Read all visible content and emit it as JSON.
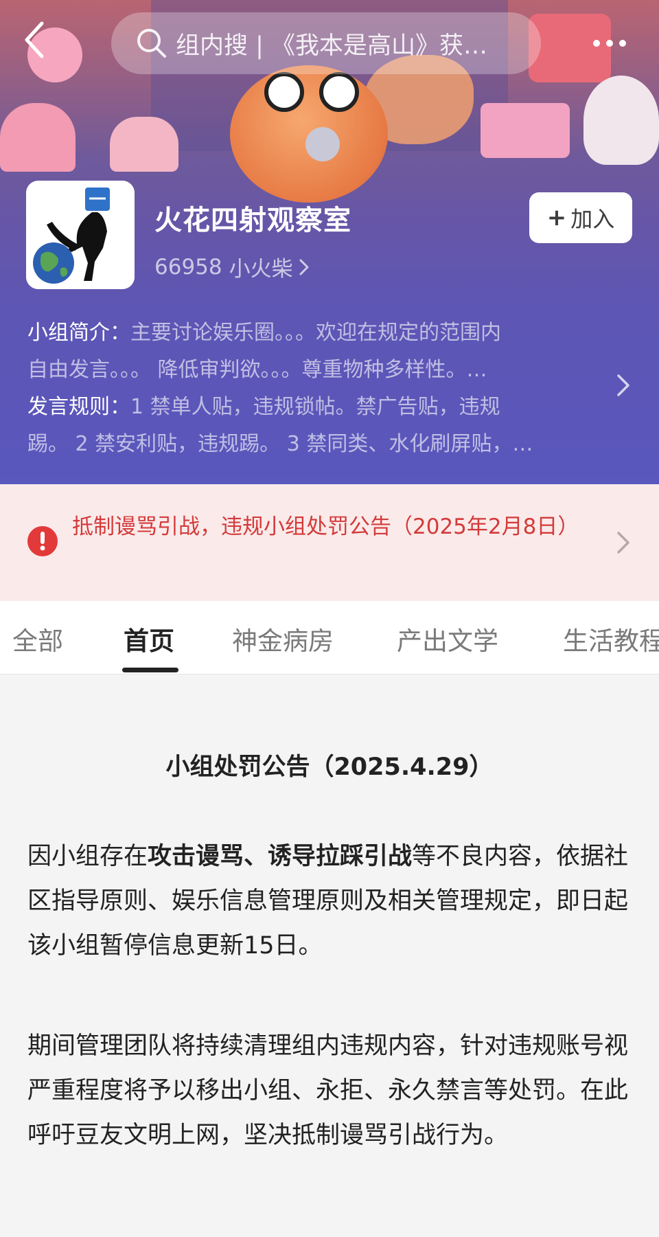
{
  "topbar": {
    "search_placeholder": "组内搜 | 《我本是高山》获…"
  },
  "group": {
    "name": "火花四射观察室",
    "member_count": "66958",
    "member_unit": "小火柴",
    "join_label": "加入"
  },
  "intro": {
    "line1_label": "小组简介：",
    "line1_text": "主要讨论娱乐圈。。。欢迎在规定的范围内",
    "line2_text": "自由发言。。。 降低审判欲。。。尊重物种多样性。…",
    "line3_label": "发言规则：",
    "line3_text": "1 禁单人贴，违规锁帖。禁广告贴，违规",
    "line4_text": "踢。 2 禁安利贴，违规踢。 3 禁同类、水化刷屏贴，…"
  },
  "notice": {
    "text": "抵制谩骂引战，违规小组处罚公告（2025年2月8日）"
  },
  "tabs": [
    "全部",
    "首页",
    "神金病房",
    "产出文学",
    "生活教程"
  ],
  "active_tab": "首页",
  "post": {
    "title": "小组处罚公告（2025.4.29）",
    "p1_pre": "因小组存在",
    "p1_bold": "攻击谩骂、诱导拉踩引战",
    "p1_post": "等不良内容，依据社区指导原则、娱乐信息管理原则及相关管理规定，即日起该小组暂停信息更新15日。",
    "p2": "期间管理团队将持续清理组内违规内容，针对违规账号视严重程度将予以移出小组、永拒、永久禁言等处罚。在此呼吁豆友文明上网，坚决抵制谩骂引战行为。"
  },
  "colors": {
    "header_purple": "#5a57bd",
    "notice_red": "#d33a3a",
    "notice_bg": "#fbeaea",
    "warn_icon": "#e23a3a"
  }
}
